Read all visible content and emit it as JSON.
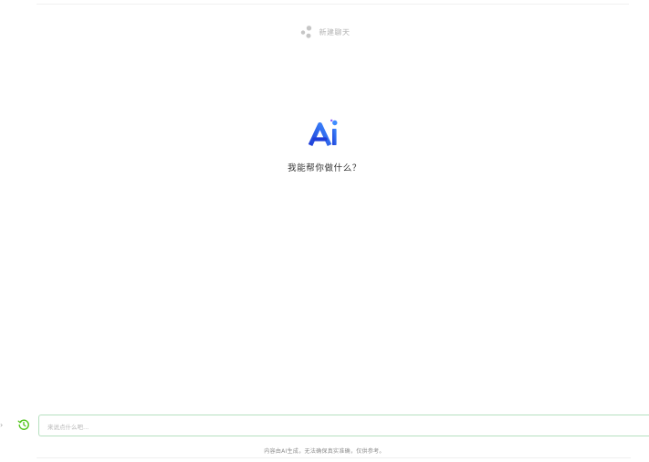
{
  "header": {
    "new_chat_label": "新建聊天",
    "new_chat_icon": "new-chat-icon"
  },
  "hero": {
    "logo_text": "Ai",
    "greeting": "我能帮你做什么？"
  },
  "composer": {
    "history_icon": "history-icon",
    "placeholder": "来说点什么吧...",
    "value": ""
  },
  "footer": {
    "disclaimer": "内容由AI生成，无法确保真实准确，仅供参考。"
  },
  "colors": {
    "logo_dark": "#1f3fd8",
    "logo_light": "#3f8cff",
    "accent_green": "#52c41a",
    "input_border": "#b6e0bf"
  }
}
